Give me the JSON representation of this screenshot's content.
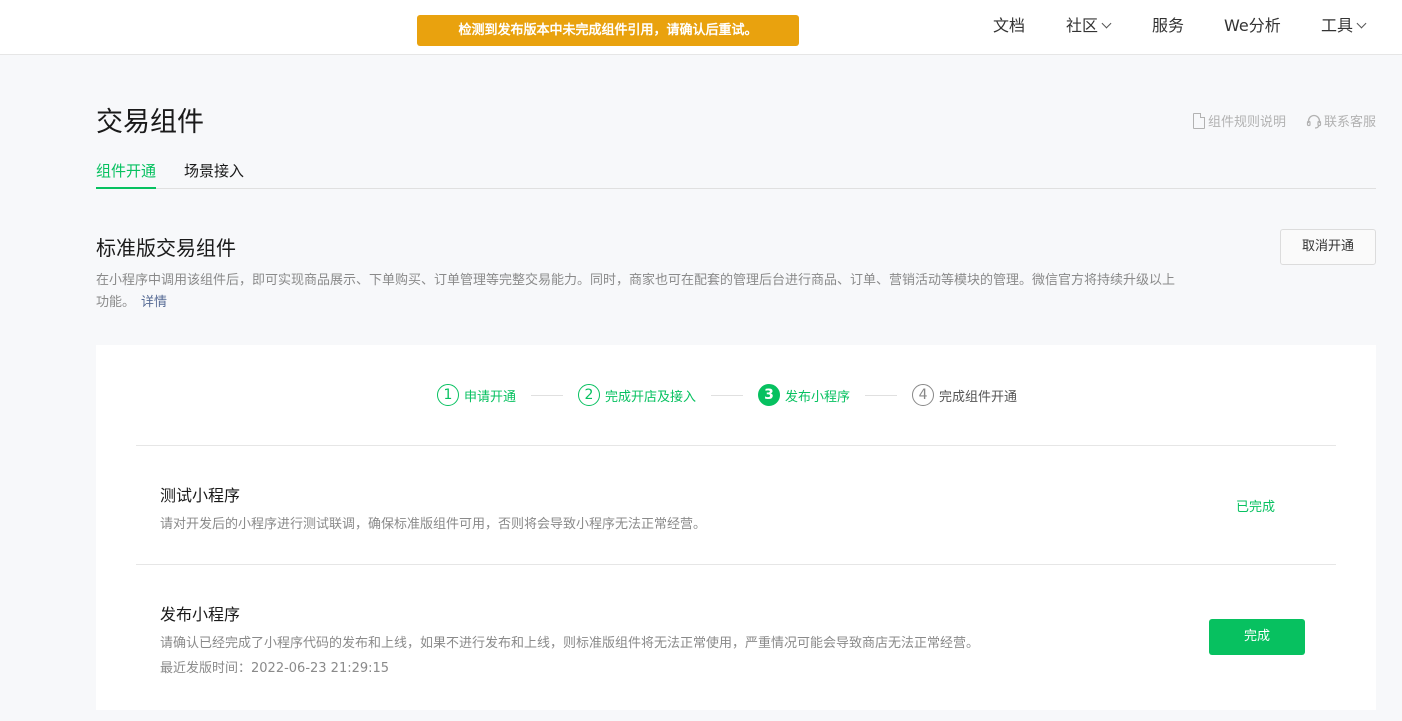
{
  "topbar": {
    "toast": "检测到发布版本中未完成组件引用，请确认后重试。",
    "nav": [
      {
        "label": "文档"
      },
      {
        "label": "社区"
      },
      {
        "label": "服务"
      },
      {
        "label": "We分析"
      },
      {
        "label": "工具"
      }
    ]
  },
  "header": {
    "title": "交易组件",
    "links": {
      "rules": "组件规则说明",
      "support": "联系客服"
    }
  },
  "tabs": [
    {
      "label": "组件开通",
      "active": true
    },
    {
      "label": "场景接入",
      "active": false
    }
  ],
  "section": {
    "title": "标准版交易组件",
    "cancel_label": "取消开通",
    "description": "在小程序中调用该组件后，即可实现商品展示、下单购买、订单管理等完整交易能力。同时，商家也可在配套的管理后台进行商品、订单、营销活动等模块的管理。微信官方将持续升级以上功能。",
    "detail_link": "详情"
  },
  "steps": [
    {
      "num": "1",
      "label": "申请开通",
      "state": "done"
    },
    {
      "num": "2",
      "label": "完成开店及接入",
      "state": "done"
    },
    {
      "num": "3",
      "label": "发布小程序",
      "state": "current"
    },
    {
      "num": "4",
      "label": "完成组件开通",
      "state": "pending"
    }
  ],
  "tasks": {
    "test": {
      "title": "测试小程序",
      "desc": "请对开发后的小程序进行测试联调，确保标准版组件可用，否则将会导致小程序无法正常经营。",
      "status": "已完成"
    },
    "publish": {
      "title": "发布小程序",
      "desc": "请确认已经完成了小程序代码的发布和上线，如果不进行发布和上线，则标准版组件将无法正常使用，严重情况可能会导致商店无法正常经营。",
      "last_release": "最近发版时间：2022-06-23 21:29:15",
      "button": "完成"
    }
  },
  "colors": {
    "accent": "#07c160",
    "warning": "#e9a20e",
    "link": "#576b95"
  }
}
